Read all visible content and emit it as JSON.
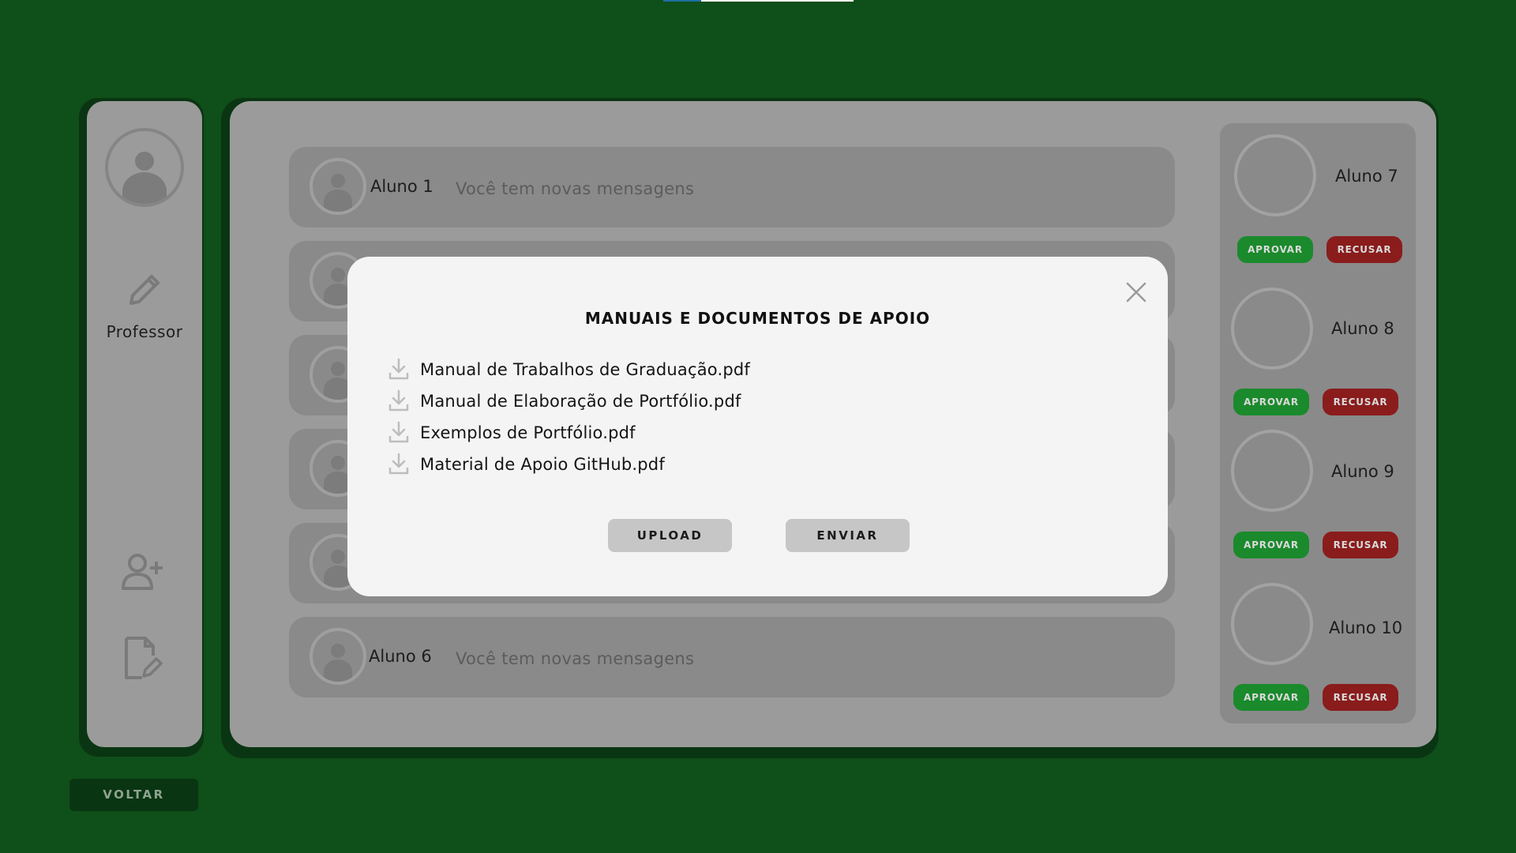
{
  "colors": {
    "background": "#0f4f1a",
    "panel": "#9b9b9b",
    "row": "#8a8a8a",
    "approve": "#1a8a2c",
    "reject": "#8a1c1c",
    "modal": "#f4f4f4"
  },
  "sidebar": {
    "user_name": "Professor",
    "icons": [
      "user-avatar-icon",
      "pencil-icon",
      "add-user-icon",
      "edit-document-icon"
    ]
  },
  "messages": {
    "rows": [
      {
        "name": "Aluno 1",
        "text": "Você tem novas mensagens"
      },
      {
        "name": "Aluno 6",
        "text": "Você tem novas mensagens"
      }
    ]
  },
  "requests": {
    "approve_label": "APROVAR",
    "reject_label": "RECUSAR",
    "students": [
      {
        "name": "Aluno 7"
      },
      {
        "name": "Aluno 8"
      },
      {
        "name": "Aluno 9"
      },
      {
        "name": "Aluno 10"
      }
    ]
  },
  "footer": {
    "back_label": "VOLTAR"
  },
  "modal": {
    "title": "MANUAIS E DOCUMENTOS DE APOIO",
    "documents": [
      {
        "label": "Manual de Trabalhos de Graduação.pdf"
      },
      {
        "label": "Manual de Elaboração de Portfólio.pdf"
      },
      {
        "label": "Exemplos de Portfólio.pdf"
      },
      {
        "label": "Material de Apoio GitHub.pdf"
      }
    ],
    "upload_label": "UPLOAD",
    "send_label": "ENVIAR"
  }
}
